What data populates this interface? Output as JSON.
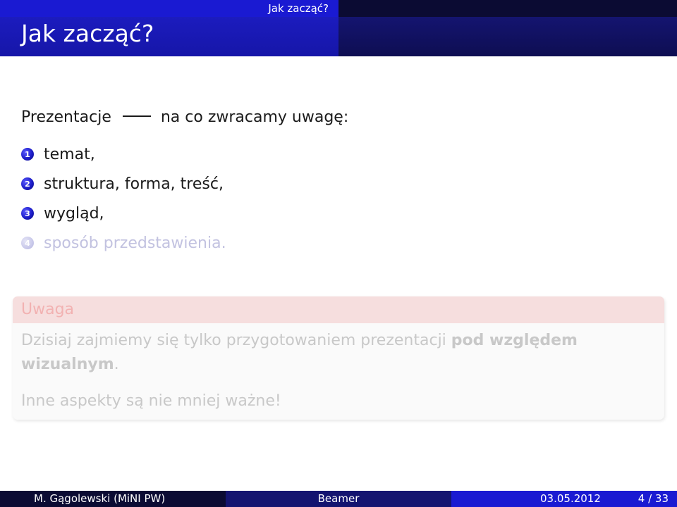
{
  "header": {
    "nav_section": "Jak zacząć?",
    "frame_title": "Jak zacząć?"
  },
  "content": {
    "intro_left": "Prezentacje",
    "intro_right": "na co zwracamy uwagę:",
    "items": [
      {
        "number": "1",
        "text": "temat,"
      },
      {
        "number": "2",
        "text": "struktura, forma, treść,"
      },
      {
        "number": "3",
        "text": "wygląd,"
      },
      {
        "number": "4",
        "text": "sposób przedstawienia."
      }
    ]
  },
  "alert": {
    "title": "Uwaga",
    "para1_plain": "Dzisiaj zajmiemy się tylko przygotowaniem prezentacji ",
    "para1_bold_a": "pod względem",
    "para1_bold_b": "wizualnym",
    "para1_end": ".",
    "para2": "Inne aspekty są nie mniej ważne!"
  },
  "footer": {
    "author": "M. Gągolewski (MiNI PW)",
    "title": "Beamer",
    "date": "03.05.2012",
    "page": "4 / 33"
  },
  "colors": {
    "primary_blue": "#1a1ad2",
    "dark_navy": "#0b0b33",
    "mid_navy": "#141470",
    "alert_title_bg": "#f6dede",
    "faded_text": "#c2c2e0"
  }
}
